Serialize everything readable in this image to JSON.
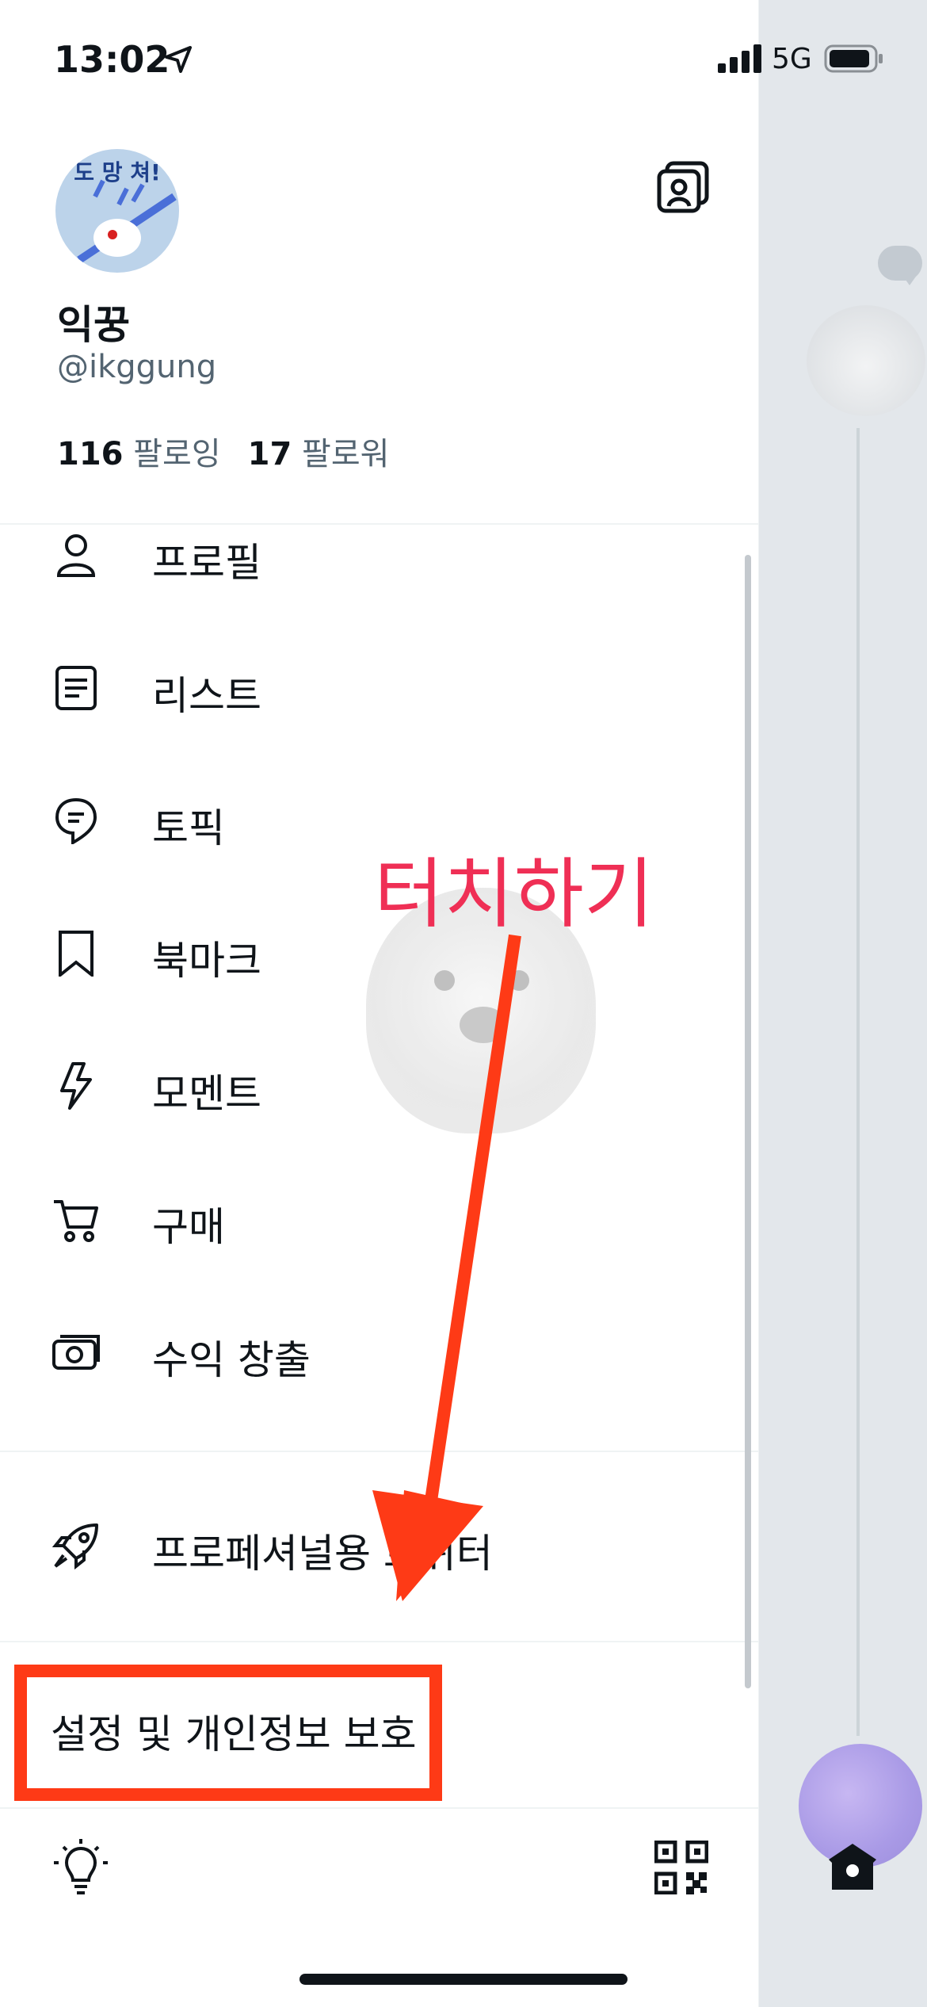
{
  "status_bar": {
    "time": "13:02",
    "network": "5G"
  },
  "profile": {
    "avatar_caption": "도 망 쳐!",
    "display_name": "익꿍",
    "handle": "@ikggung",
    "following_count": "116",
    "following_label": "팔로잉",
    "followers_count": "17",
    "followers_label": "팔로워"
  },
  "menu": {
    "items": [
      {
        "label": "프로필",
        "icon": "person-icon"
      },
      {
        "label": "리스트",
        "icon": "list-icon"
      },
      {
        "label": "토픽",
        "icon": "topic-icon"
      },
      {
        "label": "북마크",
        "icon": "bookmark-icon"
      },
      {
        "label": "모멘트",
        "icon": "lightning-icon"
      },
      {
        "label": "구매",
        "icon": "cart-icon"
      },
      {
        "label": "수익 창출",
        "icon": "money-icon"
      }
    ],
    "professional_label": "프로페셔널용 트위터",
    "settings_label": "설정 및 개인정보 보호"
  },
  "annotation": {
    "touch_text": "터치하기"
  },
  "colors": {
    "text_primary": "#0f1419",
    "text_secondary": "#536471",
    "annotation_text": "#ef2f55",
    "arrow": "#fe3a16",
    "backdrop": "#e3e7eb"
  }
}
